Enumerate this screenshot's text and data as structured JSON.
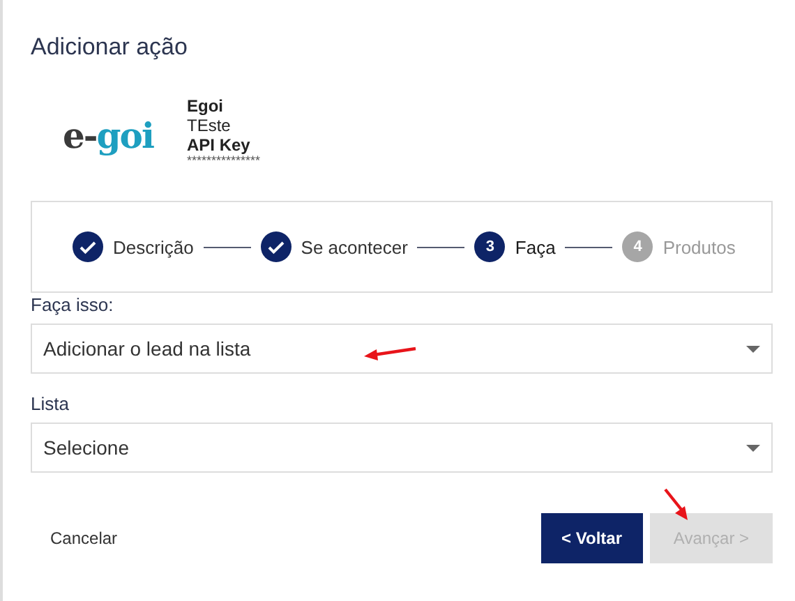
{
  "dialog": {
    "title": "Adicionar ação"
  },
  "integration": {
    "logo_parts": [
      "e-",
      "goi"
    ],
    "name": "Egoi",
    "account": "TEste",
    "key_label": "API Key",
    "key_value": "***************"
  },
  "steps": [
    {
      "label": "Descrição",
      "completed": true,
      "selected": false
    },
    {
      "label": "Se acontecer",
      "completed": true,
      "selected": false
    },
    {
      "number": "3",
      "label": "Faça",
      "completed": false,
      "selected": true
    },
    {
      "number": "4",
      "label": "Produtos",
      "completed": false,
      "selected": false
    }
  ],
  "fields": [
    {
      "label": "Faça isso:",
      "value": "Adicionar o lead na lista"
    },
    {
      "label": "Lista",
      "value": "Selecione"
    }
  ],
  "buttons": [
    {
      "label": "Cancelar",
      "kind": "link"
    },
    {
      "label": "< Voltar",
      "kind": "primary",
      "disabled": false
    },
    {
      "label": "Avançar >",
      "kind": "primary",
      "disabled": true
    }
  ]
}
